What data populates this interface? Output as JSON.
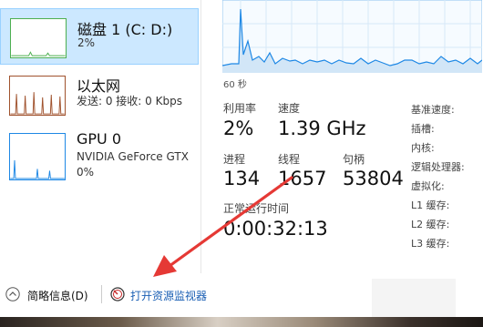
{
  "sidebar": {
    "items": [
      {
        "title": "磁盘 1 (C: D:)",
        "subtitle": "2%",
        "color": "#4caf50"
      },
      {
        "title": "以太网",
        "subtitle": "发送: 0 接收: 0 Kbps",
        "color": "#a0522d"
      },
      {
        "title": "GPU 0",
        "subtitle": "NVIDIA GeForce GTX",
        "subtitle2": "0%",
        "color": "#1e88e5"
      }
    ]
  },
  "graph": {
    "x_label": "60 秒",
    "color": "#1e88e5"
  },
  "stats": {
    "utilization_label": "利用率",
    "utilization_value": "2%",
    "speed_label": "速度",
    "speed_value": "1.39 GHz",
    "processes_label": "进程",
    "processes_value": "134",
    "threads_label": "线程",
    "threads_value": "1657",
    "handles_label": "句柄",
    "handles_value": "53804",
    "uptime_label": "正常运行时间",
    "uptime_value": "0:00:32:13"
  },
  "properties": [
    "基准速度:",
    "插槽:",
    "内核:",
    "逻辑处理器:",
    "虚拟化:",
    "L1 缓存:",
    "L2 缓存:",
    "L3 缓存:"
  ],
  "footer": {
    "collapse_label": "简略信息(D)",
    "monitor_link": "打开资源监视器"
  },
  "accent": "#e53935"
}
